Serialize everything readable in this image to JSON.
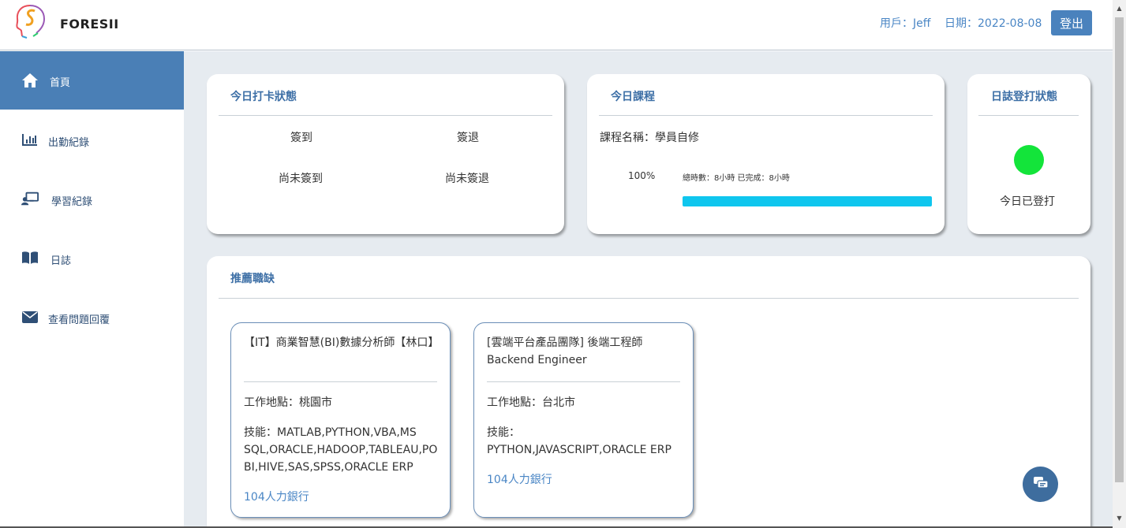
{
  "header": {
    "logo_text": "FORESII",
    "user_label": "用戶：Jeff",
    "date_label": "日期：2022-08-08",
    "logout_label": "登出"
  },
  "sidebar": {
    "items": [
      {
        "label": "首頁",
        "icon": "home-icon",
        "active": true
      },
      {
        "label": "出勤紀錄",
        "icon": "bar-chart-icon",
        "active": false
      },
      {
        "label": "學習紀錄",
        "icon": "teacher-board-icon",
        "active": false
      },
      {
        "label": "日誌",
        "icon": "book-icon",
        "active": false
      },
      {
        "label": "查看問題回覆",
        "icon": "envelope-icon",
        "active": false
      }
    ]
  },
  "punch_card": {
    "title": "今日打卡狀態",
    "checkin_label": "簽到",
    "checkout_label": "簽退",
    "checkin_status": "尚未簽到",
    "checkout_status": "尚未簽退"
  },
  "course_card": {
    "title": "今日課程",
    "course_name": "課程名稱：學員自修",
    "percent": "100%",
    "hours_text": "總時數：8小時 已完成：8小時",
    "progress": 1.0,
    "progress_color": "#0fc6ee"
  },
  "log_card": {
    "title": "日誌登打狀態",
    "status_text": "今日已登打",
    "status_color": "#13e43a"
  },
  "jobs_card": {
    "title": "推薦職缺",
    "jobs": [
      {
        "title": "【IT】商業智慧(BI)數據分析師【林口】",
        "location": "工作地點：桃園市",
        "skills": "技能：MATLAB,PYTHON,VBA,MS SQL,ORACLE,HADOOP,TABLEAU,PO BI,HIVE,SAS,SPSS,ORACLE ERP",
        "source": "104人力銀行"
      },
      {
        "title": "[雲端平台產品團隊] 後端工程師 Backend Engineer",
        "location": "工作地點：台北市",
        "skills": "技能：\nPYTHON,JAVASCRIPT,ORACLE ERP",
        "source": "104人力銀行"
      }
    ]
  },
  "fab": {
    "icon": "chat-icon"
  },
  "colors": {
    "accent": "#4a82bd",
    "sidebar_active": "#4a7fb6",
    "main_bg": "#e6ebf0"
  }
}
